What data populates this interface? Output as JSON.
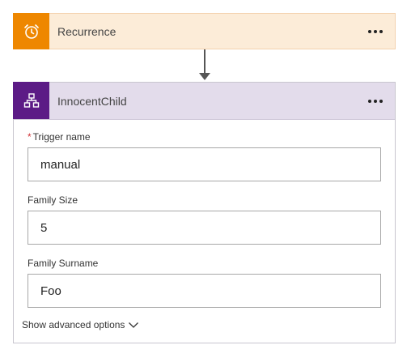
{
  "recurrence": {
    "title": "Recurrence",
    "accent": "#ee8700",
    "header_bg": "#fcecd8",
    "icon": "alarm-clock-icon"
  },
  "child": {
    "title": "InnocentChild",
    "accent": "#5c1b86",
    "header_bg": "#e3dceb",
    "icon": "hierarchy-icon",
    "fields": [
      {
        "label": "Trigger name",
        "required": "*",
        "value": "manual"
      },
      {
        "label": "Family Size",
        "value": "5"
      },
      {
        "label": "Family Surname",
        "value": "Foo"
      }
    ],
    "advanced_label": "Show advanced options"
  },
  "menu_icon": "more-options-icon",
  "connector_icon": "arrow-down-icon"
}
